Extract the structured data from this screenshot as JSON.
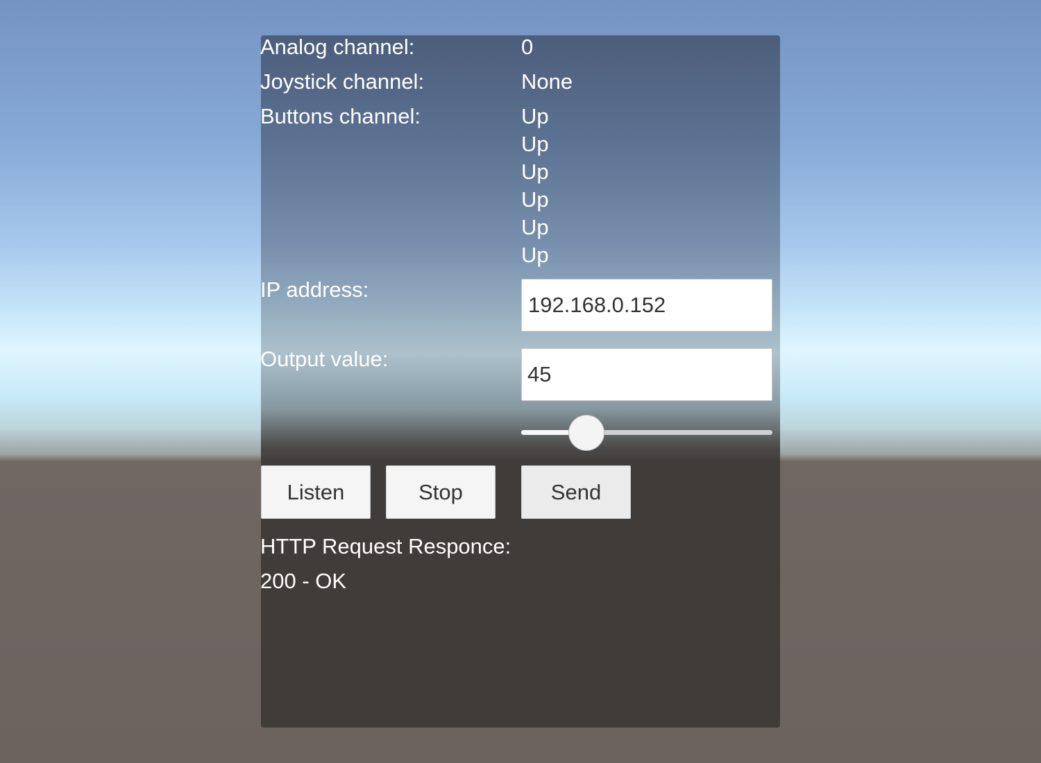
{
  "labels": {
    "analog": "Analog channel:",
    "joystick": "Joystick channel:",
    "buttons": "Buttons channel:",
    "ip": "IP address:",
    "output": "Output value:",
    "http": "HTTP Request Responce:"
  },
  "values": {
    "analog": "0",
    "joystick": "None",
    "buttons": [
      "Up",
      "Up",
      "Up",
      "Up",
      "Up",
      "Up"
    ]
  },
  "fields": {
    "ip": "192.168.0.152",
    "output": "45"
  },
  "slider": {
    "fraction": 0.26
  },
  "buttons": {
    "listen": "Listen",
    "stop": "Stop",
    "send": "Send"
  },
  "http_response": "200 - OK"
}
